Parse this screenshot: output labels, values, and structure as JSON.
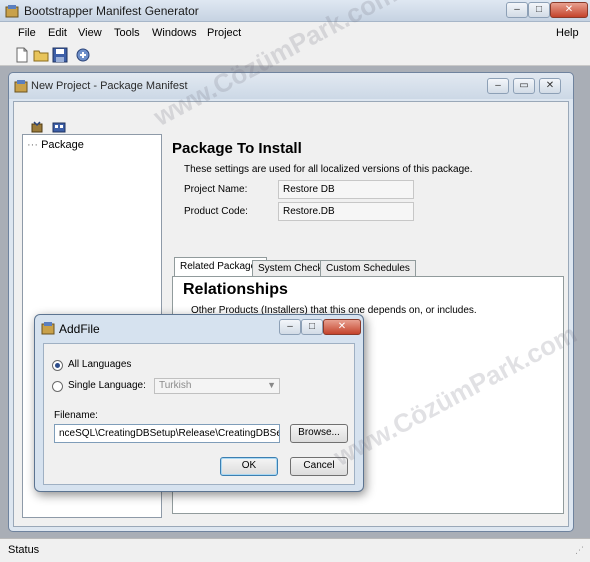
{
  "app": {
    "title": "Bootstrapper Manifest Generator"
  },
  "menu": {
    "file": "File",
    "edit": "Edit",
    "view": "View",
    "tools": "Tools",
    "windows": "Windows",
    "project": "Project",
    "help": "Help"
  },
  "toolbar": {
    "icons": [
      "new-file-icon",
      "open-folder-icon",
      "save-icon",
      "build-icon"
    ]
  },
  "child_window": {
    "title": "New Project - Package Manifest",
    "tree": {
      "items": [
        "Package"
      ]
    },
    "panel": {
      "heading": "Package To Install",
      "description": "These settings are used for all localized versions of this package.",
      "project_name_label": "Project Name:",
      "project_name_value": "Restore DB",
      "product_code_label": "Product Code:",
      "product_code_value": "Restore.DB"
    },
    "tabs": [
      "Related Packages",
      "System Checks",
      "Custom Schedules"
    ],
    "active_tab": "Related Packages",
    "tab_page": {
      "heading": "Relationships",
      "description": "Other Products (Installers) that this one depends on, or includes."
    }
  },
  "dialog": {
    "title": "AddFile",
    "all_languages_label": "All Languages",
    "single_language_label": "Single Language:",
    "language_value": "Turkish",
    "filename_label": "Filename:",
    "filename_value": "nceSQL\\CreatingDBSetup\\Release\\CreatingDBSetup.msi",
    "browse_label": "Browse...",
    "ok_label": "OK",
    "cancel_label": "Cancel"
  },
  "status": {
    "text": "Status"
  },
  "watermark": "www.CözümPark.com"
}
